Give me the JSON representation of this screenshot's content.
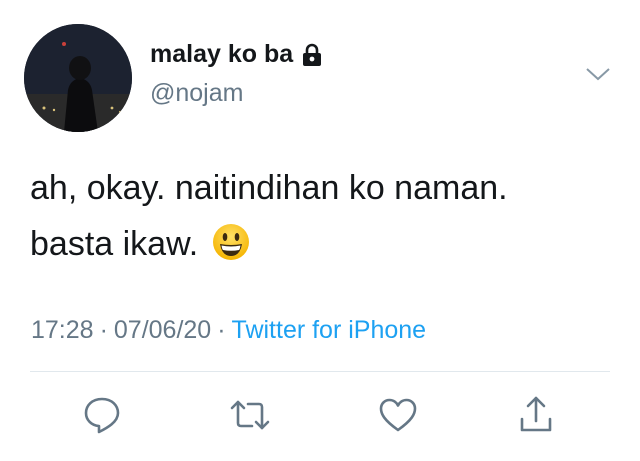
{
  "user": {
    "display_name": "malay ko ba",
    "handle": "@nojam",
    "protected_icon": "lock-icon"
  },
  "tweet": {
    "lines": [
      "ah, okay. naitindihan ko naman.",
      "basta ikaw."
    ],
    "emoji": "grinning-face-emoji",
    "time": "17:28",
    "date": "07/06/20",
    "separator": "·",
    "source": "Twitter for iPhone"
  },
  "actions": [
    "reply-icon",
    "retweet-icon",
    "like-icon",
    "share-icon"
  ],
  "colors": {
    "text": "#14171a",
    "secondary": "#657786",
    "link": "#1da1f2",
    "icon": "#657786",
    "divider": "#e1e8ed"
  }
}
